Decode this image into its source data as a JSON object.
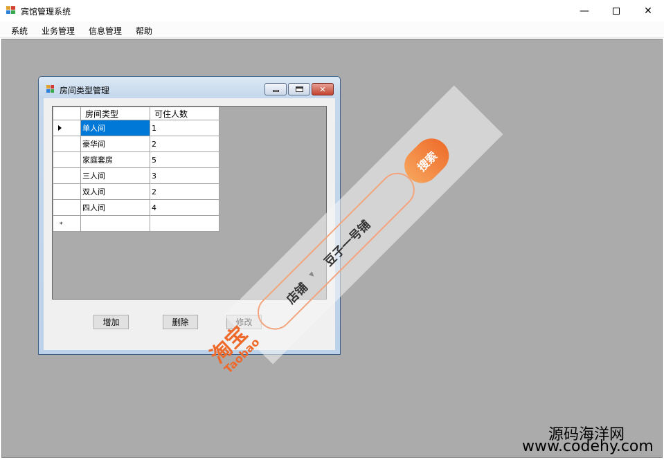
{
  "window": {
    "title": "宾馆管理系统"
  },
  "menu": [
    "系统",
    "业务管理",
    "信息管理",
    "帮助"
  ],
  "child": {
    "title": "房间类型管理",
    "columns": [
      "房间类型",
      "可住人数"
    ],
    "rows": [
      [
        "单人间",
        "1"
      ],
      [
        "豪华间",
        "2"
      ],
      [
        "家庭套房",
        "5"
      ],
      [
        "三人间",
        "3"
      ],
      [
        "双人间",
        "2"
      ],
      [
        "四人间",
        "4"
      ]
    ],
    "new_row_marker": "*",
    "buttons": {
      "add": "增加",
      "delete": "删除",
      "edit": "修改"
    }
  },
  "watermark": {
    "logo_cn": "淘宝",
    "logo_en": "Taobao",
    "shop_label": "店铺",
    "shop_name": "豆子一号铺",
    "search": "搜索"
  },
  "site": {
    "name": "源码海洋网",
    "url": "www.codehy.com"
  },
  "colors": {
    "mdi_bg": "#ababab",
    "selection": "#0078d7",
    "accent": "#ee6a2a"
  }
}
